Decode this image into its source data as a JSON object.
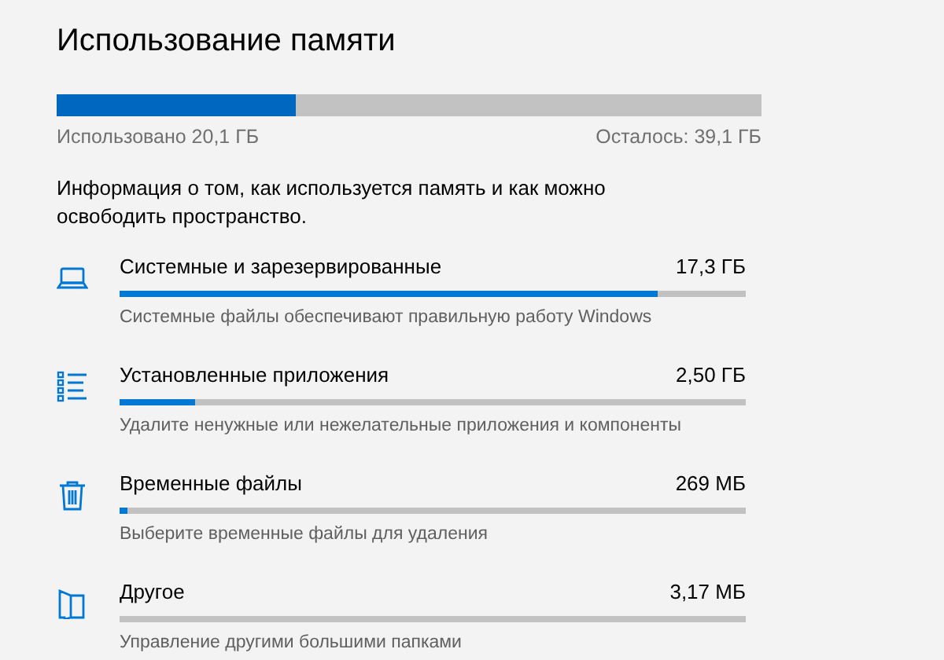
{
  "title": "Использование памяти",
  "usage": {
    "level": 0.34,
    "used": "Использовано 20,1 ГБ",
    "left": "Осталось: 39,1 ГБ"
  },
  "description": "Информация о том, как используется память и как можно освободить пространство.",
  "categories": [
    {
      "kind": "system",
      "name": "Системные и зарезервированные",
      "size": "17,3 ГБ",
      "level": 0.86,
      "hint": "Системные файлы обеспечивают правильную работу Windows"
    },
    {
      "kind": "apps",
      "name": "Установленные приложения",
      "size": "2,50 ГБ",
      "level": 0.12,
      "hint": "Удалите ненужные или нежелательные приложения и компоненты"
    },
    {
      "kind": "temp",
      "name": "Временные файлы",
      "size": "269 МБ",
      "level": 0.012,
      "hint": "Выберите временные файлы для удаления"
    },
    {
      "kind": "other",
      "name": "Другое",
      "size": "3,17 МБ",
      "level": 0,
      "hint": "Управление другими большими папками"
    }
  ]
}
